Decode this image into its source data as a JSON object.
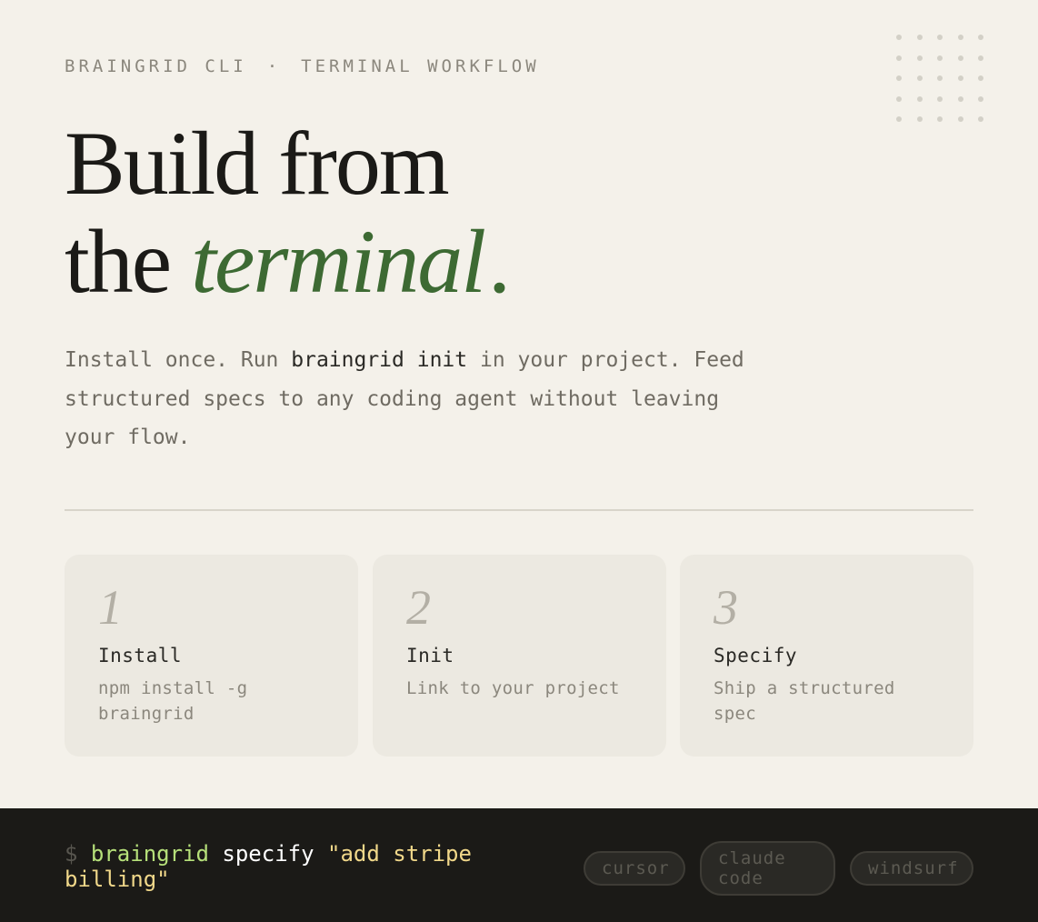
{
  "eyebrow": {
    "left": "BRAINGRID CLI",
    "separator": "·",
    "right": "TERMINAL WORKFLOW"
  },
  "headline": {
    "line1": "Build from",
    "line2_plain": "the",
    "line2_accent": "terminal",
    "period": "."
  },
  "lede": {
    "part1": "Install once. Run ",
    "command": "braingrid init",
    "part2": " in your project. Feed structured specs to any coding agent without leaving your flow."
  },
  "steps": [
    {
      "number": "1",
      "title": "Install",
      "description": "npm install -g braingrid"
    },
    {
      "number": "2",
      "title": "Init",
      "description": "Link to your project"
    },
    {
      "number": "3",
      "title": "Specify",
      "description": "Ship a structured spec"
    }
  ],
  "terminal": {
    "prompt": "$",
    "binary": "braingrid",
    "subcommand": "specify",
    "argument": "\"add stripe billing\""
  },
  "agents": [
    "cursor",
    "claude code",
    "windsurf"
  ],
  "colors": {
    "background": "#f4f1ea",
    "accent_green": "#3d6a33",
    "terminal_bg": "#1b1a17",
    "terminal_binary": "#b6e07a",
    "terminal_string": "#f1d88a"
  }
}
